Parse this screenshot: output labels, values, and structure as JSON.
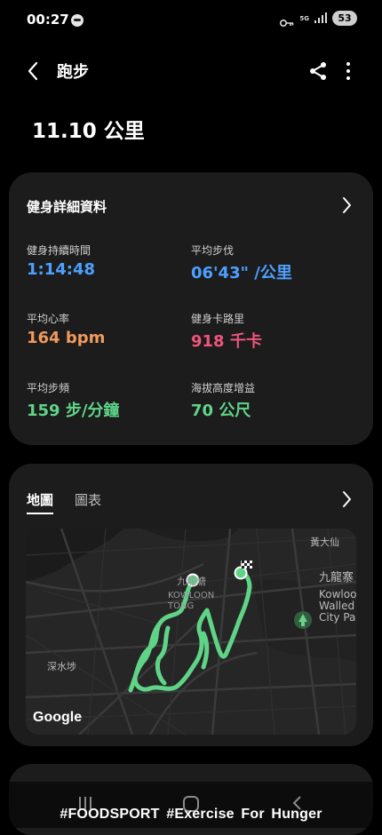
{
  "status_bar": {
    "time": "00:27",
    "network": "5G",
    "battery": "53",
    "icons": [
      "notification-dot-icon",
      "key-icon",
      "signal-icon",
      "battery-icon"
    ]
  },
  "app_bar": {
    "title": "跑步",
    "icons": [
      "back-icon",
      "share-icon",
      "more-vert-icon"
    ]
  },
  "summary": {
    "distance": "11.10 公里"
  },
  "workout_details": {
    "title": "健身詳細資料",
    "stats": [
      {
        "label": "健身持續時間",
        "value": "1:14:48",
        "color": "#4da0ff"
      },
      {
        "label": "平均步伐",
        "value": "06'43\" /公里",
        "color": "#4da0ff"
      },
      {
        "label": "平均心率",
        "value": "164 bpm",
        "color": "#f29a5c"
      },
      {
        "label": "健身卡路里",
        "value": "918 千卡",
        "color": "#f0557d"
      },
      {
        "label": "平均步頻",
        "value": "159 步/分鐘",
        "color": "#5fd487"
      },
      {
        "label": "海拔高度增益",
        "value": "70 公尺",
        "color": "#5fd487"
      }
    ]
  },
  "map_card": {
    "tabs": [
      {
        "label": "地圖",
        "active": true
      },
      {
        "label": "圖表",
        "active": false
      }
    ],
    "map_labels": {
      "wong_tai_sin": "黃大仙",
      "kowloon_tong_zh": "九龍塘",
      "kowloon_tong_en": "KOWLOON TONG",
      "kowloon_walled_city_zh": "九龍寨",
      "kowloon_walled_city_en": "Kowloon Walled City Park",
      "sham_shui_po": "深水埗"
    },
    "map_provider": "Google",
    "route_color": "#5fd487"
  },
  "nav_bar": {
    "icons": [
      "recents-icon",
      "home-icon",
      "back-nav-icon"
    ]
  },
  "watermark": "#FOODSPORT  #Exercise  For Hunger"
}
